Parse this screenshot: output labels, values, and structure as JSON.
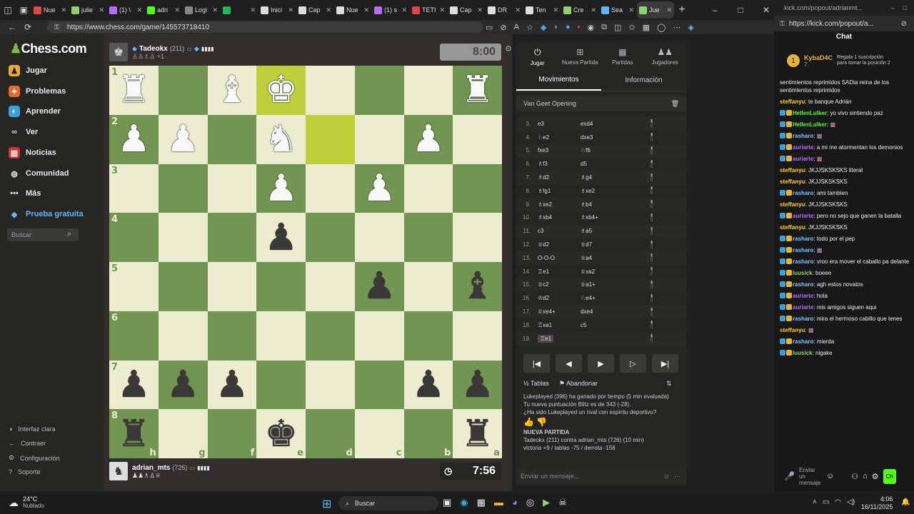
{
  "browser": {
    "tabs": [
      "Nue",
      "julie",
      "(1) \\",
      "adri",
      "Logi",
      "",
      "Inici",
      "Cap",
      "Nue",
      "(1) s",
      "TETI",
      "Cap",
      "DR",
      "Ten",
      "Cre",
      "Sea",
      "Jue"
    ],
    "url": "https://www.chess.com/game/145573718410"
  },
  "popup": {
    "title": "kick.com/popout/adrianmt...",
    "url": "https://kick.com/popout/a..."
  },
  "sidebar": {
    "logo": "Chess.com",
    "items": [
      "Jugar",
      "Problemas",
      "Aprender",
      "Ver",
      "Noticias",
      "Comunidad",
      "Más",
      "Prueba gratuita"
    ],
    "search_placeholder": "Buscar",
    "settings": [
      "Interfaz clara",
      "Contraer",
      "Configuración",
      "Soporte"
    ]
  },
  "top_player": {
    "name": "Tadeokx",
    "rating": "(211)",
    "extra": "+1",
    "clock": "8:00"
  },
  "bottom_player": {
    "name": "adrian_mts",
    "rating": "(726)",
    "clock": "7:56"
  },
  "board": {
    "ranks": [
      "1",
      "2",
      "3",
      "4",
      "5",
      "6",
      "7",
      "8"
    ],
    "files": [
      "h",
      "g",
      "f",
      "e",
      "d",
      "c",
      "b",
      "a"
    ],
    "rows": [
      [
        "wR",
        "",
        "wB",
        "wK",
        "",
        "",
        "",
        "wR"
      ],
      [
        "wP",
        "wP",
        "",
        "wN",
        "",
        "",
        "wP",
        ""
      ],
      [
        "",
        "",
        "",
        "wP",
        "",
        "wP",
        "",
        ""
      ],
      [
        "",
        "",
        "",
        "bP",
        "",
        "",
        "",
        ""
      ],
      [
        "",
        "",
        "",
        "",
        "",
        "bP",
        "",
        "bB"
      ],
      [
        "",
        "",
        "",
        "",
        "",
        "",
        "",
        ""
      ],
      [
        "bP",
        "bP",
        "bP",
        "",
        "",
        "",
        "bP",
        "bP"
      ],
      [
        "bR",
        "",
        "",
        "bK",
        "",
        "",
        "",
        "bR"
      ]
    ]
  },
  "panel": {
    "tabs": [
      "Jugar",
      "Nueva Partida",
      "Partidas",
      "Jugadores"
    ],
    "subtabs": [
      "Movimientos",
      "Información"
    ],
    "opening": "Van Geet Opening",
    "moves": [
      {
        "n": "3.",
        "w": "e3",
        "b": "exd4"
      },
      {
        "n": "4.",
        "w": "♘e2",
        "b": "dxe3"
      },
      {
        "n": "5.",
        "w": "fxe3",
        "b": "♘f6"
      },
      {
        "n": "6.",
        "w": "♗f3",
        "b": "d5"
      },
      {
        "n": "7.",
        "w": "♗d2",
        "b": "♗g4"
      },
      {
        "n": "8.",
        "w": "♗fg1",
        "b": "♗xe2"
      },
      {
        "n": "9.",
        "w": "♗xe2",
        "b": "♗b4"
      },
      {
        "n": "10.",
        "w": "♗xb4",
        "b": "♗xb4+"
      },
      {
        "n": "11.",
        "w": "c3",
        "b": "♗a5"
      },
      {
        "n": "12.",
        "w": "♕d2",
        "b": "♕d7"
      },
      {
        "n": "13.",
        "w": "O-O-O",
        "b": "♕a4"
      },
      {
        "n": "14.",
        "w": "♖e1",
        "b": "♕xa2"
      },
      {
        "n": "15.",
        "w": "♕c2",
        "b": "♕a1+"
      },
      {
        "n": "16.",
        "w": "♔d2",
        "b": "♘e4+"
      },
      {
        "n": "17.",
        "w": "♕xe4+",
        "b": "dxe4"
      },
      {
        "n": "18.",
        "w": "♖xa1",
        "b": "c5"
      },
      {
        "n": "19.",
        "w": "♖e1",
        "b": ""
      }
    ],
    "actions": [
      "Tablas",
      "Abandonar"
    ],
    "messages": [
      "Lukeplayed (396) ha ganado por tiempo (5 min evaluada)",
      "Tu nueva puntuación Blitz es de 343 (-28).",
      "¿Ha sido Lukeplayed un rival con espíritu deportivo?",
      "NUEVA PARTIDA",
      "Tadeokx (211) contra adrian_mts (726) (10 min)",
      "victoria +9 / tablas -75 / derrota -158"
    ],
    "chat_placeholder": "Enviar un mensaje..."
  },
  "chat": {
    "title": "Chat",
    "pinned_user": "KybaD4C",
    "pinned_count": "7",
    "pinned_text": "Regala 1 suscripción para tomar la posición 2",
    "messages": [
      {
        "u": "",
        "t": "sentimientos reprimidos SADia reina de los sentimientos reprimidos"
      },
      {
        "u": "steffanyu",
        "t": "te banque Adrián"
      },
      {
        "u": "HellenLulker",
        "t": "yo vivo sintiendo paz"
      },
      {
        "u": "HellenLulker",
        "t": ""
      },
      {
        "u": "rasharo",
        "t": ""
      },
      {
        "u": "auriarte",
        "t": "a mi me atormentan los demonios"
      },
      {
        "u": "auriarte",
        "t": ""
      },
      {
        "u": "steffanyu",
        "t": "JKJJSKSKSKS literal"
      },
      {
        "u": "steffanyu",
        "t": "JKJJSKSKSKS"
      },
      {
        "u": "rasharo",
        "t": "ami tambien"
      },
      {
        "u": "steffanyu",
        "t": "JKJJSKSKSKS"
      },
      {
        "u": "auriarte",
        "t": "pero no sejo que ganen la batalla"
      },
      {
        "u": "steffanyu",
        "t": "JKJJSKSKSKS"
      },
      {
        "u": "rasharo",
        "t": "todo por el pep"
      },
      {
        "u": "rasharo",
        "t": ""
      },
      {
        "u": "rasharo",
        "t": "vroo era mover el caballo pa delante"
      },
      {
        "u": "luusick",
        "t": "boeee"
      },
      {
        "u": "rasharo",
        "t": "agh estos novatos"
      },
      {
        "u": "auriarte",
        "t": "hola"
      },
      {
        "u": "auriarte",
        "t": "mis amigos siguen aqui"
      },
      {
        "u": "rasharo",
        "t": "mira el hermoso cabillo que tenes"
      },
      {
        "u": "steffanyu",
        "t": ""
      },
      {
        "u": "rasharo",
        "t": "mierda"
      },
      {
        "u": "luusick",
        "t": "nigake"
      }
    ],
    "input_placeholder": "Enviar un mensaje"
  },
  "taskbar": {
    "weather_temp": "24°C",
    "weather_desc": "Nublado",
    "search": "Buscar",
    "time": "4:06",
    "date": "16/11/2025"
  }
}
